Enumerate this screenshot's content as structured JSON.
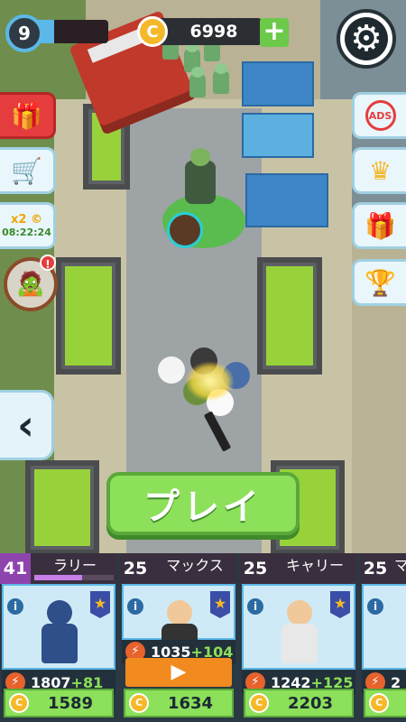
{
  "hud": {
    "level": "9",
    "xp_progress": 0.25,
    "coins": "6998",
    "add_coins": "+"
  },
  "side": {
    "timer_multiplier": "x2",
    "timer": "08:22:24",
    "avatar_badge": "!"
  },
  "play_label": "プレイ",
  "colors": {
    "accent_green": "#8ce05a",
    "accent_blue": "#5bb8e8",
    "coin_gold": "#f5b829"
  },
  "cards": [
    {
      "level": "41",
      "name": "ラリー",
      "progress": 0.6,
      "power": "1807",
      "power_plus": "+81",
      "price": "1589",
      "has_video": false
    },
    {
      "level": "25",
      "name": "マックス",
      "progress": 0.0,
      "power": "1035",
      "power_plus": "+104",
      "price": "1634",
      "has_video": true
    },
    {
      "level": "25",
      "name": "キャリー",
      "progress": 0.0,
      "power": "1242",
      "power_plus": "+125",
      "price": "2203",
      "has_video": false
    },
    {
      "level": "25",
      "name": "マ",
      "progress": 0.0,
      "power": "2",
      "power_plus": "",
      "price": "",
      "has_video": false
    }
  ]
}
